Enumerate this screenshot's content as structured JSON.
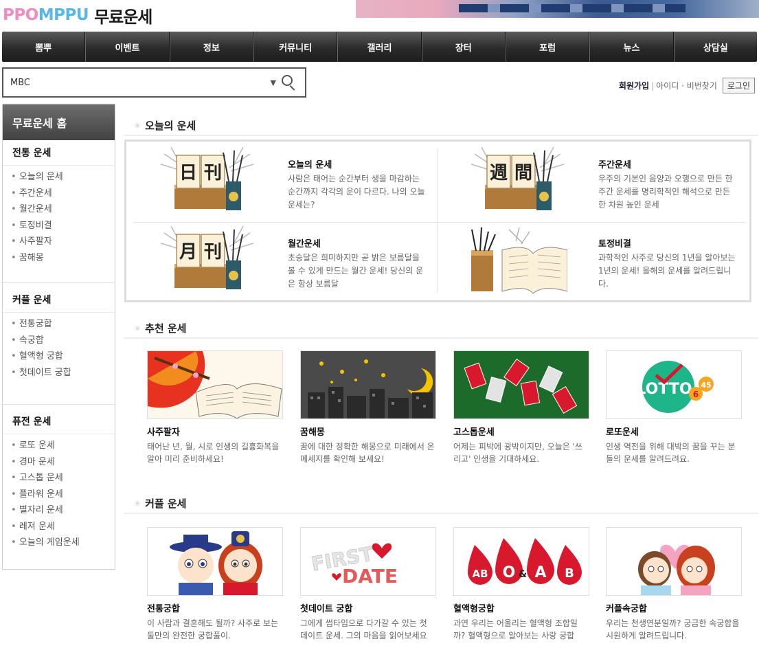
{
  "header": {
    "brand": "PPOMPPU",
    "title": "무료운세"
  },
  "gnb": [
    "뽐뿌",
    "이벤트",
    "정보",
    "커뮤니티",
    "갤러리",
    "장터",
    "포럼",
    "뉴스",
    "상담실"
  ],
  "search": {
    "value": "MBC"
  },
  "member": {
    "join": "회원가입",
    "find": "아이디 · 비번찾기",
    "login": "로그인"
  },
  "sidebar": {
    "home": "무료운세 홈",
    "sections": [
      {
        "title": "전통 운세",
        "items": [
          "오늘의 운세",
          "주간운세",
          "월간운세",
          "토정비결",
          "사주팔자",
          "꿈해몽"
        ]
      },
      {
        "title": "커플 운세",
        "items": [
          "전통궁합",
          "속궁합",
          "혈액형 궁합",
          "첫데이트 궁합"
        ]
      },
      {
        "title": "퓨전 운세",
        "items": [
          "로또 운세",
          "경마 운세",
          "고스톱 운세",
          "플라워 운세",
          "별자리 운세",
          "레져 운세",
          "오늘의 게임운세"
        ]
      }
    ]
  },
  "today": {
    "title": "오늘의 운세",
    "cards": [
      {
        "title": "오늘의 운세",
        "desc": "사람은 태어는 순간부터 생을 마감하는 순간까지 각각의 운이 다르다. 나의 오늘 운세는?",
        "chars": [
          "日",
          "刊"
        ]
      },
      {
        "title": "주간운세",
        "desc": "우주의 기본인 음양과 오행으로 만든 한 주간 운세를 명리학적인 해석으로 만든 한 차원 높인 운세",
        "chars": [
          "週",
          "間"
        ]
      },
      {
        "title": "월간운세",
        "desc": "초승달은 희미하지만 곧 밝은 보름달을 볼 수 있게 만드는 월간 운세! 당신의 운은 항상 보름달",
        "chars": [
          "月",
          "刊"
        ]
      },
      {
        "title": "토정비결",
        "desc": "과학적인 사주로 당신의 1년을 알아보는 1년의 운세! 올해의 운세를 알려드립니다.",
        "chars": []
      }
    ]
  },
  "recommend": {
    "title": "추천 운세",
    "tiles": [
      {
        "title": "사주팔자",
        "desc": "태어난 년, 월, 시로 인생의 길흉화복을 알아 미리 준비하세요!"
      },
      {
        "title": "꿈해몽",
        "desc": "꿈에 대한 정확한 해몽으로 미래에서 온 메세지를 확인해 보세요!"
      },
      {
        "title": "고스톱운세",
        "desc": "어제는 피박에 광박이지만, 오늘은 '쓰리고' 인생을 기대하세요."
      },
      {
        "title": "로또운세",
        "desc": "인생 역전을 위해 대박의 꿈을 꾸는 분들의 운세를 알려드려요.",
        "logo": "LOTTO",
        "num1": "6",
        "num2": "45"
      }
    ]
  },
  "couple": {
    "title": "커플 운세",
    "tiles": [
      {
        "title": "전통궁합",
        "desc": "이 사람과 결혼해도 될까? 사주로 보는 둘만의 완전한 궁합풀이."
      },
      {
        "title": "첫데이트 궁합",
        "desc": "그에게 썸타임으로 다가갈 수 있는 첫 데이트 운세. 그의 마음을 읽어보세요",
        "img1": "FIRST",
        "img2": "DATE"
      },
      {
        "title": "혈액형궁합",
        "desc": "과연 우리는 어울리는 혈액형 조합일까? 혈액형으로 알아보는 사랑 궁합",
        "drops": [
          "AB",
          "O",
          "&",
          "A",
          "B"
        ]
      },
      {
        "title": "커플속궁합",
        "desc": "우리는 천생연분일까? 궁금한 속궁합을 시원하게 알려드립니다."
      }
    ]
  },
  "colors": {
    "gnb": "#2b2b2b",
    "accent_pink": "#f08bc0",
    "accent_blue": "#55b8e8",
    "blood": "#d8182c"
  }
}
